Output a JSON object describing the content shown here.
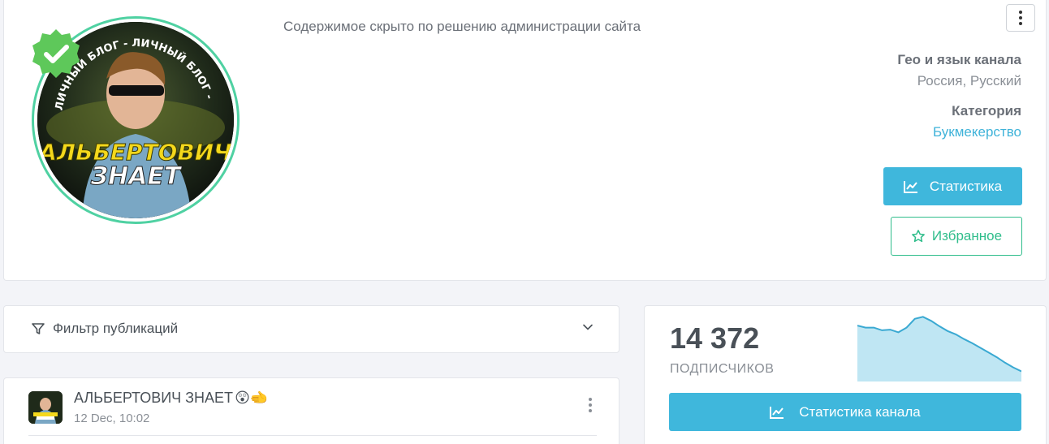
{
  "channel": {
    "hidden_notice": "Содержимое скрыто по решению администрации сайта",
    "avatar_text_line1": "АЛЬБЕРТОВИЧ",
    "avatar_text_line2": "ЗНАЕТ",
    "avatar_ring_text": "ЛИЧНЫЙ БЛОГ - ЛИЧНЫЙ БЛОГ -",
    "geo_label": "Гео и язык канала",
    "geo_value": "Россия, Русский",
    "category_label": "Категория",
    "category_value": "Букмекерство",
    "stats_button": "Статистика",
    "favorite_button": "Избранное"
  },
  "filter": {
    "label": "Фильтр публикаций"
  },
  "post": {
    "title": "АЛЬБЕРТОВИЧ ЗНАЕТ",
    "title_emojis": "😲🫲",
    "time": "12 Dec, 10:02"
  },
  "subscribers": {
    "count": "14 372",
    "label": "ПОДПИСЧИКОВ",
    "stats_button": "Статистика канала",
    "trend": [
      0.83,
      0.8,
      0.8,
      0.76,
      0.77,
      0.73,
      0.8,
      0.93,
      0.96,
      0.9,
      0.82,
      0.75,
      0.7,
      0.63,
      0.57,
      0.5,
      0.43,
      0.36,
      0.28,
      0.21,
      0.15
    ]
  },
  "colors": {
    "accent_blue": "#3fb7dc",
    "accent_green": "#2fbd8b",
    "verified_green": "#5ec85a",
    "ring": "#4fd1a2"
  }
}
